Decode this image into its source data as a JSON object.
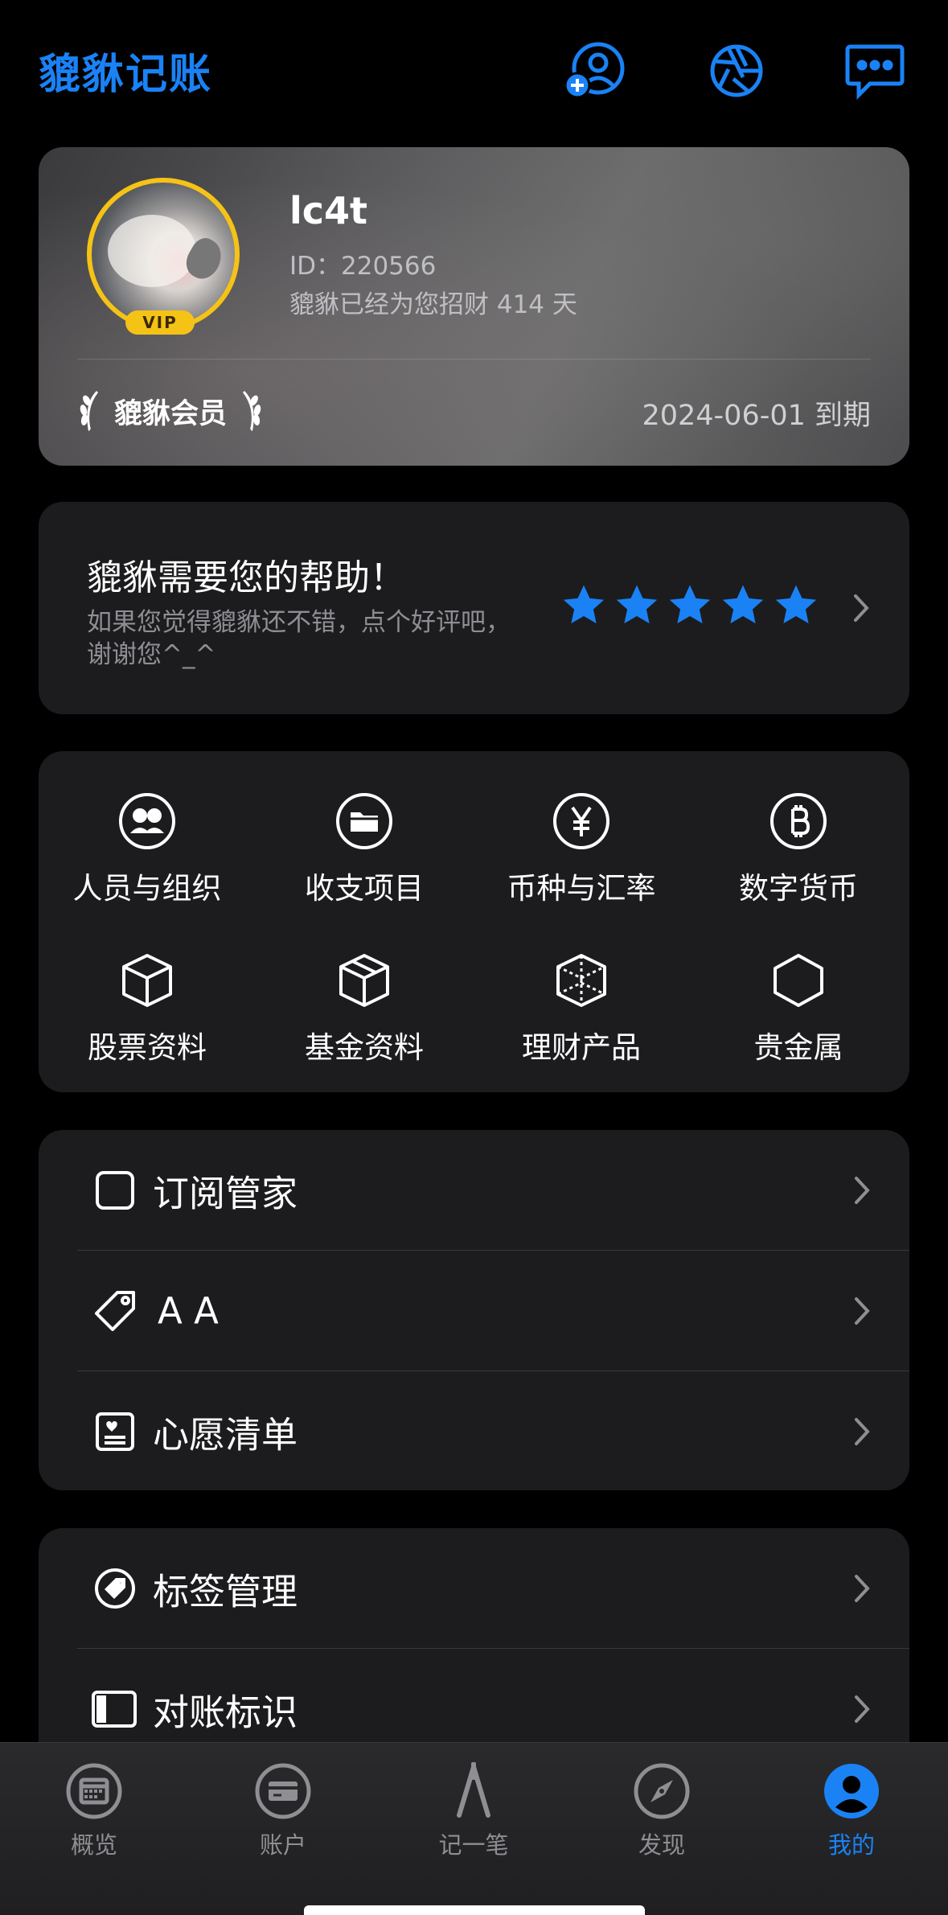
{
  "app": {
    "title": "貔貅记账"
  },
  "header_icons": [
    "add-person-icon",
    "aperture-icon",
    "message-icon"
  ],
  "profile": {
    "username": "lc4t",
    "id_text": "ID：220566",
    "days_text": "貔貅已经为您招财 414 天",
    "vip_badge": "VIP",
    "member_label": "貔貅会员",
    "expire_text": "2024-06-01 到期"
  },
  "rating": {
    "title": "貔貅需要您的帮助！",
    "subtitle": "如果您觉得貔貅还不错，点个好评吧，谢谢您^_^",
    "stars": 5,
    "accent": "#1a82f5"
  },
  "grid": {
    "items": [
      {
        "label": "人员与组织",
        "icon": "people-icon"
      },
      {
        "label": "收支项目",
        "icon": "folder-icon"
      },
      {
        "label": "币种与汇率",
        "icon": "yen-icon"
      },
      {
        "label": "数字货币",
        "icon": "bitcoin-icon"
      },
      {
        "label": "股票资料",
        "icon": "cube-icon"
      },
      {
        "label": "基金资料",
        "icon": "box-icon"
      },
      {
        "label": "理财产品",
        "icon": "cube-transparent-icon"
      },
      {
        "label": "贵金属",
        "icon": "hexagon-icon"
      }
    ]
  },
  "list1": {
    "items": [
      {
        "label": "订阅管家",
        "icon": "square-icon"
      },
      {
        "label": "A A",
        "icon": "tag-icon"
      },
      {
        "label": "心愿清单",
        "icon": "wishlist-icon"
      }
    ]
  },
  "list2": {
    "items": [
      {
        "label": "标签管理",
        "icon": "tag-circle-icon"
      },
      {
        "label": "对账标识",
        "icon": "sidebar-icon"
      }
    ]
  },
  "tabbar": {
    "tabs": [
      {
        "label": "概览",
        "icon": "calendar-icon",
        "active": false
      },
      {
        "label": "账户",
        "icon": "card-icon",
        "active": false
      },
      {
        "label": "记一笔",
        "icon": "compass-pen-icon",
        "active": false
      },
      {
        "label": "发现",
        "icon": "safari-icon",
        "active": false
      },
      {
        "label": "我的",
        "icon": "person-circle-icon",
        "active": true
      }
    ]
  },
  "colors": {
    "accent": "#1a82f5",
    "vip_gold": "#f5c316",
    "card_bg": "#1c1c1e"
  }
}
